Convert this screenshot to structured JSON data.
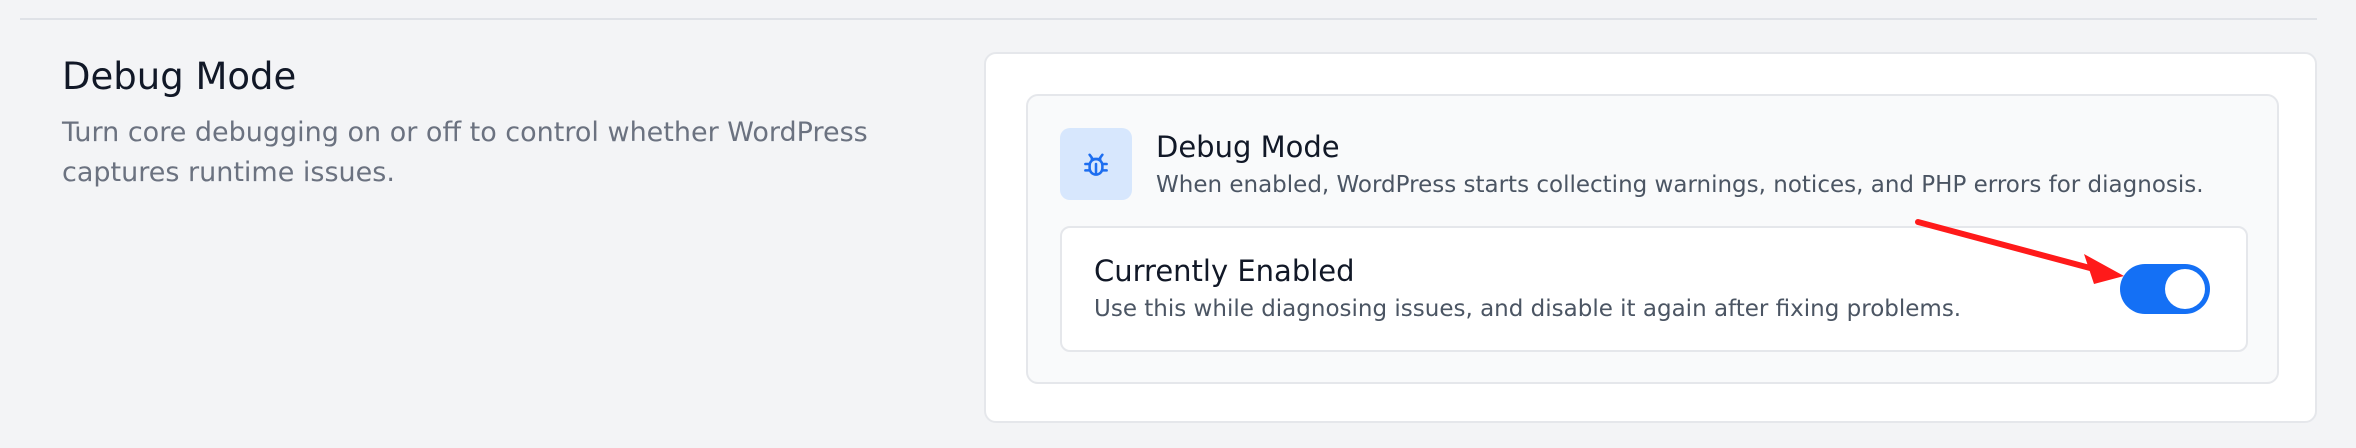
{
  "section": {
    "title": "Debug Mode",
    "description": "Turn core debugging on or off to control whether WordPress captures runtime issues."
  },
  "feature": {
    "icon": "bug-icon",
    "title": "Debug Mode",
    "description": "When enabled, WordPress starts collecting warnings, notices, and PHP errors for diagnosis."
  },
  "toggle": {
    "title": "Currently Enabled",
    "description": "Use this while diagnosing issues, and disable it again after fixing problems.",
    "enabled": true
  },
  "colors": {
    "accent": "#1470f5",
    "icon_tile": "#d7e7fd",
    "annotation_arrow": "#ff1a1a"
  }
}
